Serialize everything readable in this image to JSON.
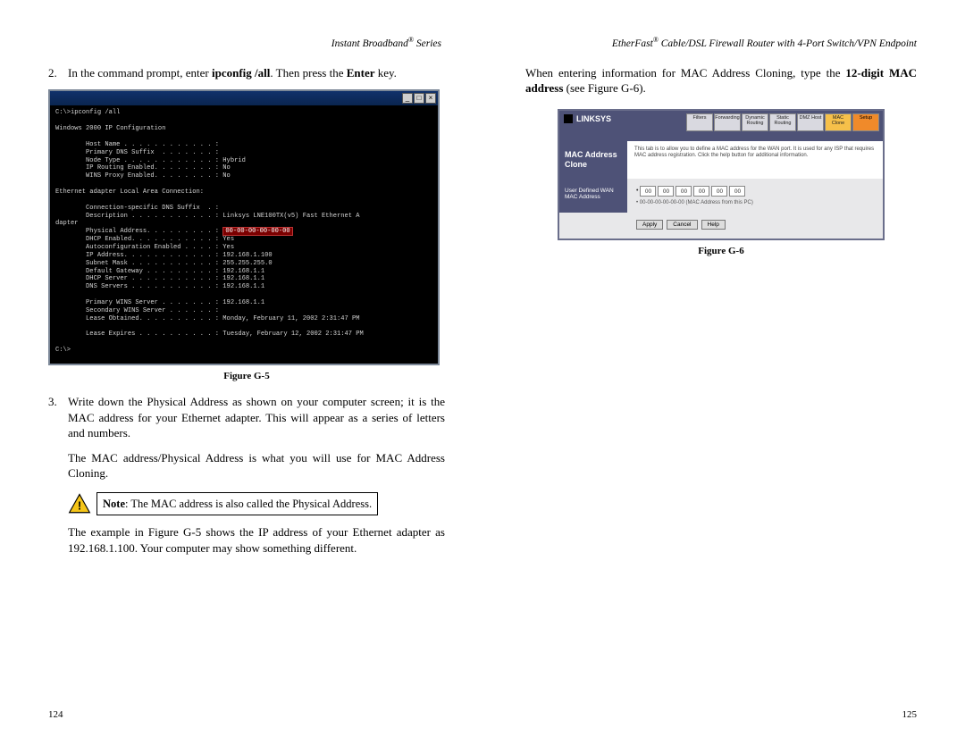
{
  "left": {
    "header_prefix": "Instant Broadband",
    "header_suffix": " Series",
    "step2_num": "2.",
    "step2_a": "In the command prompt, enter ",
    "step2_b": "ipconfig /all",
    "step2_c": ". Then press the ",
    "step2_d": "Enter",
    "step2_e": " key.",
    "cmd_btn_min": "_",
    "cmd_btn_max": "□",
    "cmd_btn_close": "×",
    "cmd_line01": "C:\\>ipconfig /all",
    "cmd_line02": "",
    "cmd_line03": "Windows 2000 IP Configuration",
    "cmd_line04": "",
    "cmd_line05": "        Host Name . . . . . . . . . . . . :",
    "cmd_line06": "        Primary DNS Suffix  . . . . . . . :",
    "cmd_line07": "        Node Type . . . . . . . . . . . . : Hybrid",
    "cmd_line08": "        IP Routing Enabled. . . . . . . . : No",
    "cmd_line09": "        WINS Proxy Enabled. . . . . . . . : No",
    "cmd_line10": "",
    "cmd_line11": "Ethernet adapter Local Area Connection:",
    "cmd_line12": "",
    "cmd_line13": "        Connection-specific DNS Suffix  . :",
    "cmd_line14": "        Description . . . . . . . . . . . : Linksys LNE100TX(v5) Fast Ethernet A",
    "cmd_line15": "dapter",
    "cmd_line16a": "        Physical Address. . . . . . . . . : ",
    "cmd_line16b": "00-00-00-00-00-00",
    "cmd_line17": "        DHCP Enabled. . . . . . . . . . . : Yes",
    "cmd_line18": "        Autoconfiguration Enabled . . . . : Yes",
    "cmd_line19": "        IP Address. . . . . . . . . . . . : 192.168.1.100",
    "cmd_line20": "        Subnet Mask . . . . . . . . . . . : 255.255.255.0",
    "cmd_line21": "        Default Gateway . . . . . . . . . : 192.168.1.1",
    "cmd_line22": "        DHCP Server . . . . . . . . . . . : 192.168.1.1",
    "cmd_line23": "        DNS Servers . . . . . . . . . . . : 192.168.1.1",
    "cmd_line24": "",
    "cmd_line25": "        Primary WINS Server . . . . . . . : 192.168.1.1",
    "cmd_line26": "        Secondary WINS Server . . . . . . :",
    "cmd_line27": "        Lease Obtained. . . . . . . . . . : Monday, February 11, 2002 2:31:47 PM",
    "cmd_line28": "",
    "cmd_line29": "        Lease Expires . . . . . . . . . . : Tuesday, February 12, 2002 2:31:47 PM",
    "cmd_line30": "",
    "cmd_line31": "C:\\>",
    "fig5": "Figure G-5",
    "step3_num": "3.",
    "step3": "Write down the Physical Address as shown on your computer screen; it is the MAC address for your Ethernet adapter.  This will appear as a series of letters and numbers.",
    "para1": "The MAC address/Physical Address is what you will use for MAC Address Cloning.",
    "note_a": "Note",
    "note_b": ": The MAC address is also called the Physical Address.",
    "para2": "The example in Figure G-5 shows the IP address of your Ethernet adapter as 192.168.1.100. Your computer may show something different.",
    "pagenum": "124"
  },
  "right": {
    "header_prefix": "EtherFast",
    "header_suffix": " Cable/DSL Firewall Router with 4-Port Switch/VPN Endpoint",
    "intro_a": "When entering information for MAC Address Cloning, type the ",
    "intro_b": "12-digit MAC address",
    "intro_c": " (see Figure G-6).",
    "logo": "LINKSYS",
    "tabs": [
      "Filters",
      "Forwarding",
      "Dynamic Routing",
      "Static Routing",
      "DMZ Host",
      "MAC Clone",
      "Setup"
    ],
    "side_title": "MAC Address Clone",
    "help_text": "This tab is to allow you to define a MAC address for the WAN port. It is used for any ISP that requires MAC address registration. Click the help button for additional information.",
    "form_side": "User Defined WAN MAC Address",
    "mac0": "00",
    "mac1": "00",
    "mac2": "00",
    "mac3": "00",
    "mac4": "00",
    "mac5": "00",
    "mac_row2_prefix": "• ",
    "mac_row2": "00-00-00-00-00-00 (MAC Address from this PC)",
    "btn_apply": "Apply",
    "btn_cancel": "Cancel",
    "btn_help": "Help",
    "fig6": "Figure G-6",
    "pagenum": "125"
  }
}
